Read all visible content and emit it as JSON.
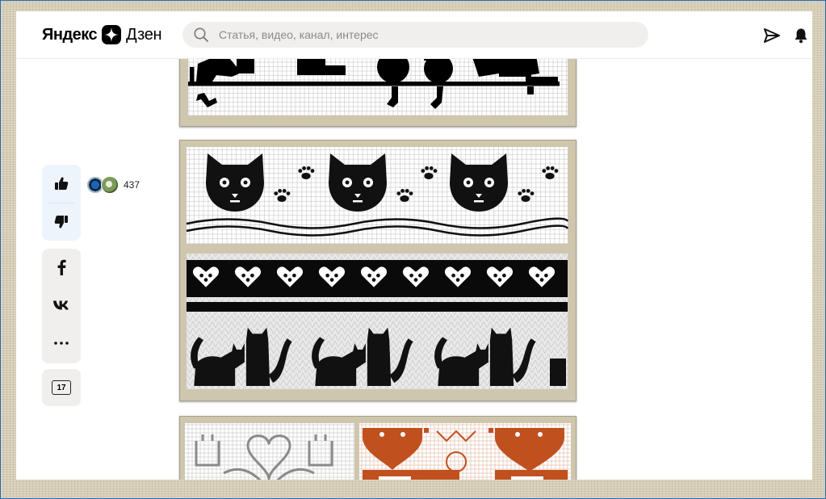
{
  "header": {
    "logo_yandex": "Яндекс",
    "logo_dzen": "Дзен",
    "search_placeholder": "Статья, видео, канал, интерес",
    "icons": [
      "search-icon",
      "send-icon",
      "bell-icon"
    ]
  },
  "rail": {
    "likes_count": "437",
    "comments_count": "17",
    "icons": [
      "thumbs-up-icon",
      "thumbs-down-icon",
      "facebook-icon",
      "vk-icon",
      "more-icon",
      "comment-icon"
    ]
  },
  "article": {
    "images": [
      {
        "alt": "",
        "chart": "cats-row-bottom"
      },
      {
        "alt": "",
        "chart": "cats-faces-hearts-silhouettes"
      },
      {
        "alt": "",
        "chart": "hearts-cats-and-red-pattern"
      }
    ]
  },
  "colors": {
    "linen": "#ddd5bf",
    "accent_blue": "#1f6fb5",
    "search_bg": "#f0efed",
    "pattern_red": "#c1501f"
  }
}
